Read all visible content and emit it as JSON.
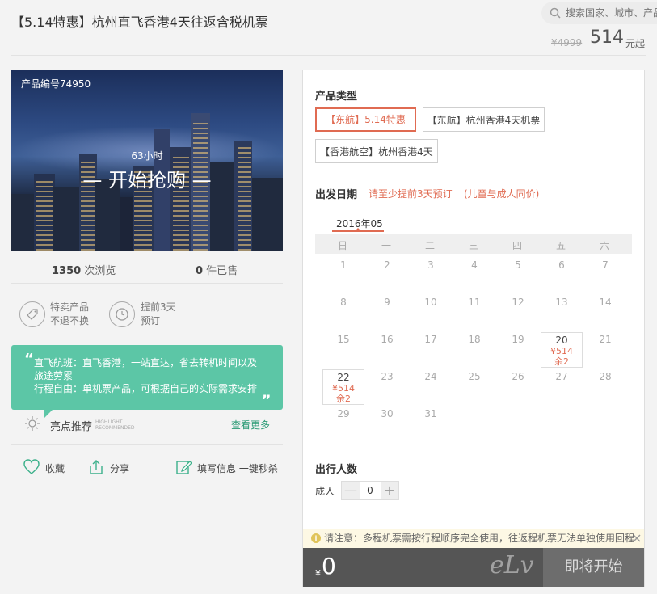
{
  "header": {
    "title": "【5.14特惠】杭州直飞香港4天往返含税机票",
    "search_placeholder": "搜索国家、城市、产品",
    "price_old": "¥4999",
    "price_now": "514",
    "price_unit": "元起"
  },
  "hero": {
    "product_no": "产品编号74950",
    "hours": "63小时",
    "start_buy": "— 开始抢购 —"
  },
  "stats": {
    "views_num": "1350",
    "views_label": " 次浏览",
    "sold_num": "0",
    "sold_label": " 件已售"
  },
  "features": [
    {
      "line1": "特卖产品",
      "line2": "不退不换",
      "icon": "tag-icon"
    },
    {
      "line1": "提前3天",
      "line2": "预订",
      "icon": "clock-icon"
    }
  ],
  "highlight": {
    "text_lines": [
      "直飞航班：直飞香港，一站直达，省去转机时间以及",
      "旅途劳累",
      "行程自由：单机票产品，可根据自己的实际需求安排"
    ],
    "label": "亮点推荐",
    "label_en_1": "HIGHLIGHT",
    "label_en_2": "RECOMMENDED",
    "see_more": "查看更多"
  },
  "actions": {
    "favorite": "收藏",
    "share": "分享",
    "fill_info": "填写信息 一键秒杀"
  },
  "panel": {
    "product_type_title": "产品类型",
    "options": [
      {
        "label": "【东航】5.14特惠",
        "selected": true
      },
      {
        "label": "【东航】杭州香港4天机票",
        "selected": false
      },
      {
        "label": "【香港航空】杭州香港4天",
        "selected": false
      }
    ],
    "date_title": "出发日期",
    "date_note1": "请至少提前3天预订",
    "date_note2": "(儿童与成人同价)",
    "month": "2016年05",
    "weekdays": [
      "日",
      "一",
      "二",
      "三",
      "四",
      "五",
      "六"
    ],
    "days": [
      "1",
      "2",
      "3",
      "4",
      "5",
      "6",
      "7",
      "8",
      "9",
      "10",
      "11",
      "12",
      "13",
      "14",
      "15",
      "16",
      "17",
      "18",
      "19",
      "20",
      "21",
      "22",
      "23",
      "24",
      "25",
      "26",
      "27",
      "28",
      "29",
      "30",
      "31"
    ],
    "available": [
      {
        "day": "20",
        "price": "¥514",
        "left": "余2"
      },
      {
        "day": "22",
        "price": "¥514",
        "left": "余2"
      }
    ],
    "travelers_title": "出行人数",
    "adult_label": "成人",
    "adult_count": "0",
    "minus": "—",
    "plus": "+",
    "notice": "请注意：多程机票需按行程顺序完全使用，往返程机票无法单独使用回程",
    "total_symbol": "¥",
    "total": "0",
    "submit": "即将开始",
    "watermark": "eLv"
  },
  "colors": {
    "accent_red": "#e06b52",
    "green": "#5cc6a6",
    "link_green": "#2a9a74",
    "bottom_bar": "#555555"
  }
}
